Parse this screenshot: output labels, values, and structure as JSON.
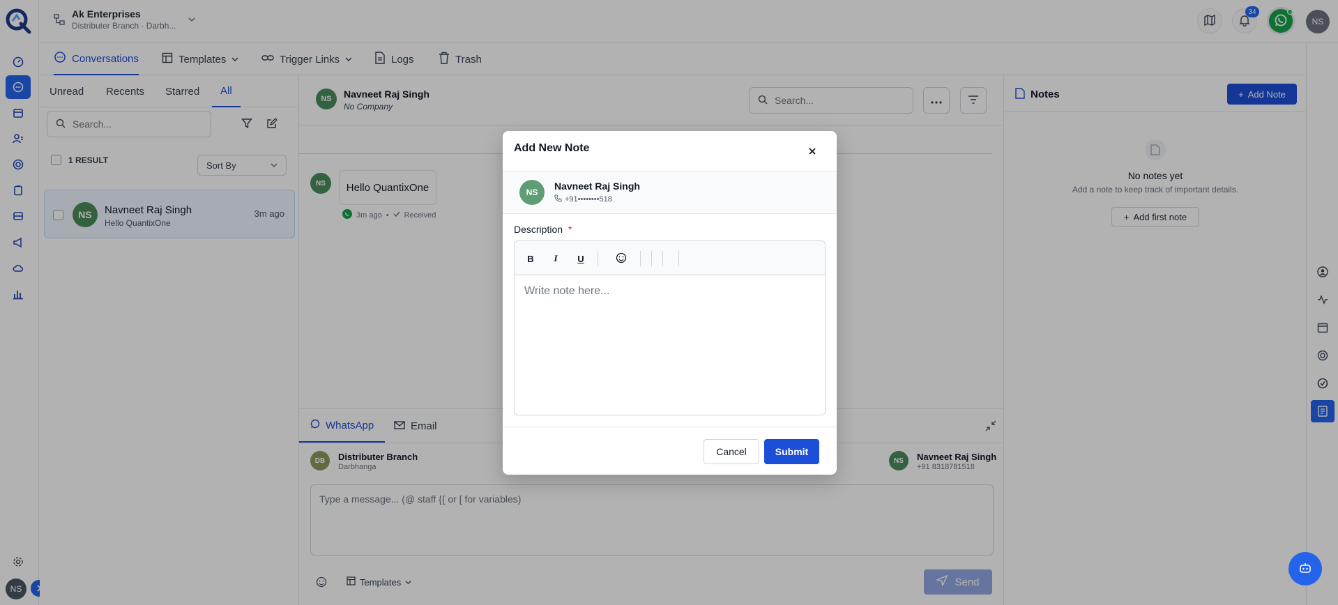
{
  "org": {
    "name": "Ak Enterprises",
    "branch": "Distributer Branch · Darbh..."
  },
  "header": {
    "notification_count": "34",
    "user_initials": "NS"
  },
  "nav": {
    "tabs": [
      {
        "label": "Conversations",
        "icon": "chat-bubble-icon"
      },
      {
        "label": "Templates",
        "icon": "template-icon"
      },
      {
        "label": "Trigger Links",
        "icon": "link-icon"
      },
      {
        "label": "Logs",
        "icon": "document-icon"
      },
      {
        "label": "Trash",
        "icon": "trash-icon"
      }
    ]
  },
  "list": {
    "filters": [
      "Unread",
      "Recents",
      "Starred",
      "All"
    ],
    "active_filter": "All",
    "search_placeholder": "Search...",
    "result_count": "1 RESULT",
    "sort_label": "Sort By",
    "items": [
      {
        "initials": "NS",
        "name": "Navneet Raj Singh",
        "preview": "Hello QuantixOne",
        "time": "3m ago"
      }
    ]
  },
  "chat": {
    "contact_initials": "NS",
    "contact_name": "Navneet Raj Singh",
    "company": "No Company",
    "search_placeholder": "Search...",
    "messages": [
      {
        "initials": "NS",
        "text": "Hello QuantixOne",
        "time": "3m ago",
        "status": "Received"
      }
    ],
    "composer": {
      "tabs": [
        "WhatsApp",
        "Email"
      ],
      "from": {
        "initials": "DB",
        "name": "Distributer Branch",
        "sub": "Darbhanga"
      },
      "to": {
        "initials": "NS",
        "name": "Navneet Raj Singh",
        "sub": "+91 8318781518"
      },
      "placeholder": "Type a message... (@ staff  {{ or [ for variables)",
      "templates_label": "Templates",
      "send_label": "Send"
    }
  },
  "notes": {
    "title": "Notes",
    "add_label": "Add Note",
    "empty_title": "No notes yet",
    "empty_text": "Add a note to keep track of important details.",
    "add_first_label": "Add first note"
  },
  "modal": {
    "title": "Add New Note",
    "contact_initials": "NS",
    "contact_name": "Navneet Raj Singh",
    "contact_phone": "+91••••••••518",
    "description_label": "Description",
    "required_mark": "*",
    "editor_placeholder": "Write note here...",
    "toolbar": {
      "bold": "B",
      "italic": "I",
      "underline": "U"
    },
    "cancel_label": "Cancel",
    "submit_label": "Submit"
  },
  "colors": {
    "accent": "#1d4ed8",
    "whatsapp": "#16a34a",
    "avatar": "#4b8b5c"
  }
}
